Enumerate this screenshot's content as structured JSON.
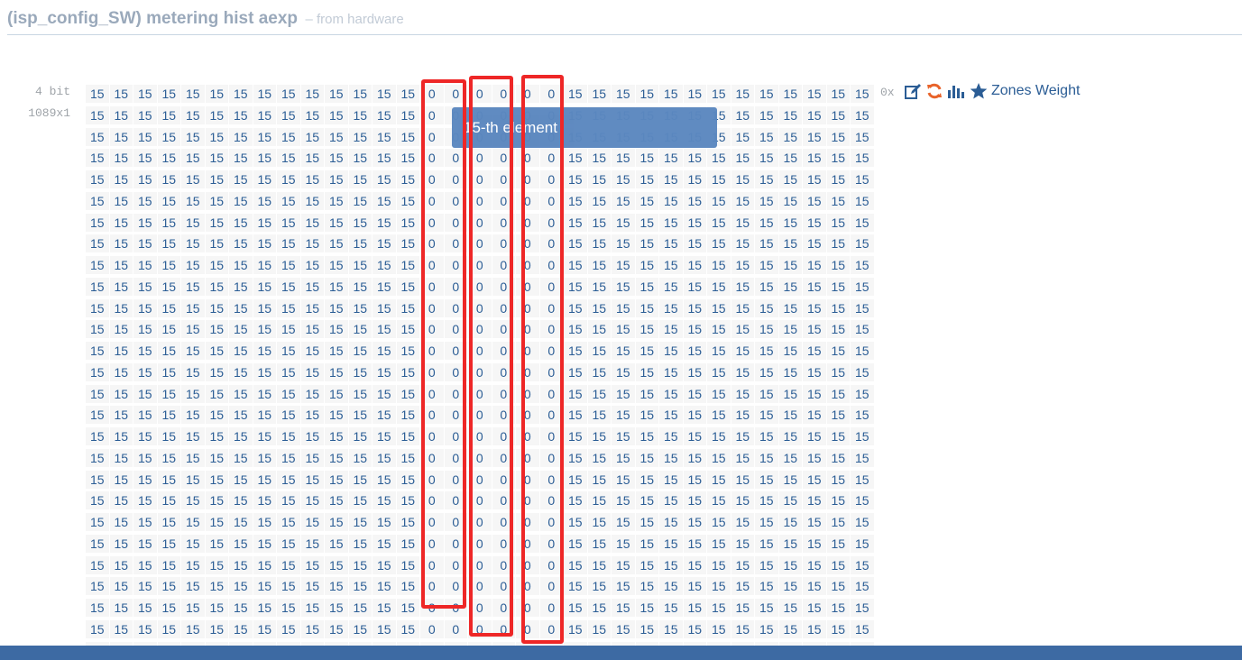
{
  "header": {
    "title": "(isp_config_SW) metering hist aexp",
    "subtitle": "– from hardware"
  },
  "meta": {
    "bit_depth": "4 bit",
    "dimensions": "1089x1"
  },
  "grid": {
    "visible_columns": 33,
    "visible_rows": 27,
    "row_pattern": [
      15,
      15,
      15,
      15,
      15,
      15,
      15,
      15,
      15,
      15,
      15,
      15,
      15,
      15,
      0,
      0,
      0,
      0,
      0,
      0,
      15,
      15,
      15,
      15,
      15,
      15,
      15,
      15,
      15,
      15,
      15,
      15,
      15
    ]
  },
  "toolbar": {
    "hex_label": "0x",
    "edit_icon": "edit-icon",
    "refresh_icon": "refresh-icon",
    "chart_icon": "bar-chart-icon",
    "star_icon": "star-icon",
    "zones_label": "Zones Weight"
  },
  "tooltip": {
    "text": "15-th element"
  },
  "colors": {
    "accent": "#2b5d95",
    "orange": "#e8632a",
    "tooltip_bg": "#5b87bf",
    "highlight": "#ee2727",
    "footer": "#3d6aa3"
  }
}
